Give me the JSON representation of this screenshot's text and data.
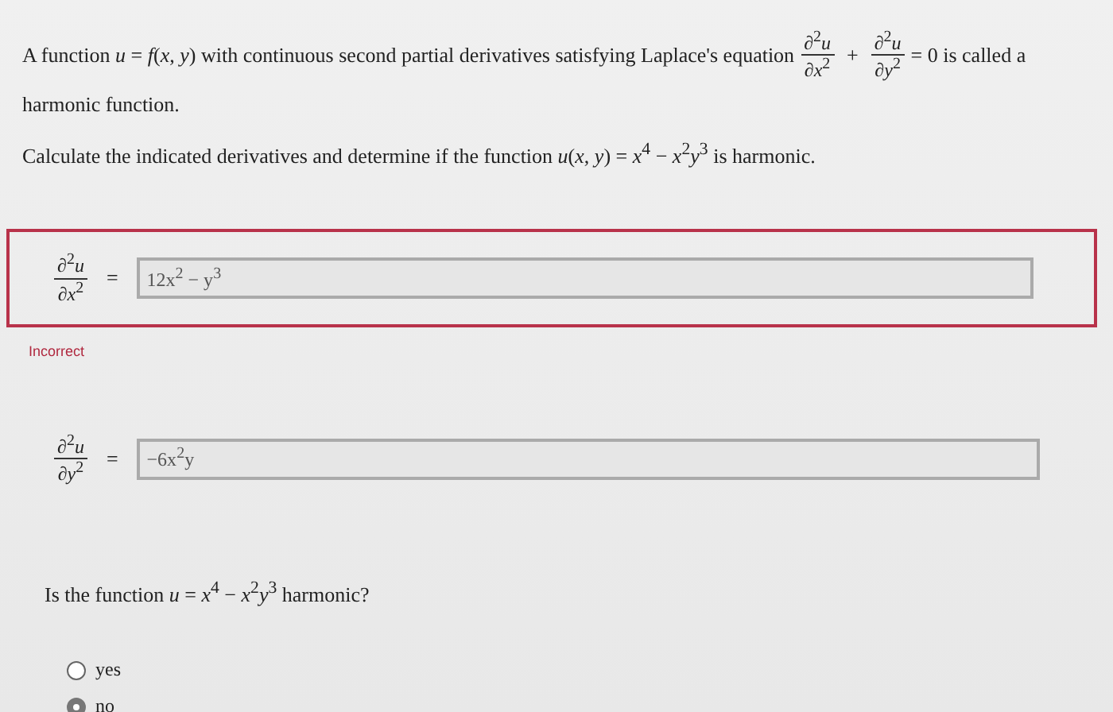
{
  "intro": {
    "text": "A function *u* = *f*(*x*, *y*) with continuous second partial derivatives satisfying Laplace's equation",
    "fractions": [
      {
        "numerator": "∂$^{2}$*u*",
        "denominator": "∂*x*$^{2}$"
      },
      {
        "numerator": "∂$^{2}$*u*",
        "denominator": "∂*y*$^{2}$"
      }
    ],
    "operator": "+",
    "after": "= 0 is called a",
    "continuation": "harmonic function."
  },
  "instruction": "Calculate the indicated derivatives and determine if the function *u*(*x*, *y*) = *x*$^{4}$ − *x*$^{2}$*y*$^{3}$ is harmonic.",
  "derivatives": [
    {
      "numerator": "∂$^{2}$*u*",
      "denominator": "∂*x*$^{2}$",
      "equals": "=",
      "value": "12x$^{2}$ − y$^{3}$",
      "incorrect": true,
      "feedback": "Incorrect"
    },
    {
      "numerator": "∂$^{2}$*u*",
      "denominator": "∂*y*$^{2}$",
      "equals": "=",
      "value": "−6x$^{2}$y",
      "incorrect": false
    }
  ],
  "question": "Is the function *u* = *x*$^{4}$ − *x*$^{2}$*y*$^{3}$ harmonic?",
  "options": [
    {
      "label": "yes",
      "selected": false
    },
    {
      "label": "no",
      "selected": true
    }
  ]
}
